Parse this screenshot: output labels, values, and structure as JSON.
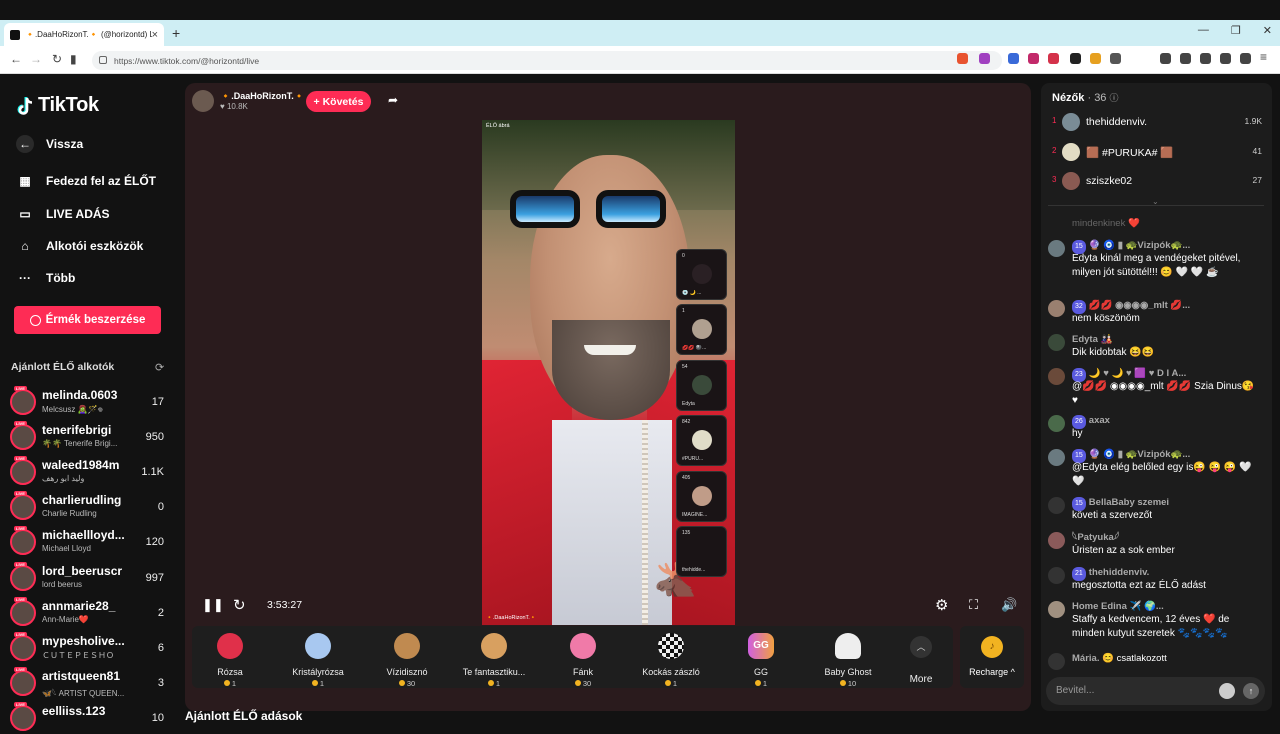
{
  "browser": {
    "tab_title": "🔸.DaaHoRizonT.🔸 (@horizontd) LIVE",
    "url": "https://www.tiktok.com/@horizontd/live"
  },
  "sidebar": {
    "logo": "TikTok",
    "items": [
      {
        "label": "Vissza",
        "icon": "back-arrow-icon"
      },
      {
        "label": "Fedezd fel az ÉLŐT",
        "icon": "calendar-icon"
      },
      {
        "label": "LIVE ADÁS",
        "icon": "camera-icon"
      },
      {
        "label": "Alkotói eszközök",
        "icon": "home-tools-icon"
      },
      {
        "label": "Több",
        "icon": "more-dots-icon"
      }
    ],
    "coins_button": "Érmék beszerzése",
    "recommended_heading": "Ajánlott ÉLŐ alkotók",
    "recommended": [
      {
        "name": "melinda.0603",
        "sub": "Melcsusz 🧟‍♀️🪄𖦹",
        "count": "17"
      },
      {
        "name": "tenerifebrigi",
        "sub": "🌴🌴 Tenerife Brigi...",
        "count": "950"
      },
      {
        "name": "waleed1984m",
        "sub": "وليد ابو رهف",
        "count": "1.1K"
      },
      {
        "name": "charlierudling",
        "sub": "Charlie Rudling",
        "count": "0"
      },
      {
        "name": "michaellloyd...",
        "sub": "Michael Lloyd",
        "count": "120"
      },
      {
        "name": "lord_beeruscr",
        "sub": "lord beerus",
        "count": "997"
      },
      {
        "name": "annmarie28_",
        "sub": "Ann-Marie❤️",
        "count": "2"
      },
      {
        "name": "mypesholive...",
        "sub": "ＣＵＴＥＰＥＳＨＯ",
        "count": "6"
      },
      {
        "name": "artistqueen81",
        "sub": "🦋𓆩 ARTIST QUEEN...",
        "count": "3"
      },
      {
        "name": "eelliiss.123",
        "sub": "",
        "count": "10"
      }
    ]
  },
  "live": {
    "host_name": "🔸.DaaHoRizonT.🔸",
    "followers": "10.8K",
    "follow_button": "+ Követés",
    "live_tag": "ÉLŐ ábrá",
    "video_name": "🔸.DaaHoRizonT.🔸",
    "guests": [
      {
        "num": "0",
        "label": "💿 🌙 ..."
      },
      {
        "num": "1",
        "label": "💋💋 🎱..."
      },
      {
        "num": "54",
        "label": "Edyta"
      },
      {
        "num": "842",
        "label": "#PURU..."
      },
      {
        "num": "405",
        "label": "IMAGINE..."
      },
      {
        "num": "135",
        "label": "thehidde..."
      }
    ],
    "time": "3:53:27"
  },
  "gifts": [
    {
      "name": "Rózsa",
      "price": "1",
      "color": "#e0304a"
    },
    {
      "name": "Kristályrózsa",
      "price": "1",
      "color": "#a8c8f0"
    },
    {
      "name": "Vízidisznó",
      "price": "30",
      "color": "#c08a50"
    },
    {
      "name": "Te fantasztiku...",
      "price": "1",
      "color": "#d8a060"
    },
    {
      "name": "Fánk",
      "price": "30",
      "color": "#f07aa8"
    },
    {
      "name": "Kockás zászló",
      "price": "1",
      "color": "#dddddd"
    },
    {
      "name": "GG",
      "price": "1",
      "color": "#d060e0"
    },
    {
      "name": "Baby Ghost",
      "price": "10",
      "color": "#eeeeee"
    }
  ],
  "more_label": "More",
  "recharge_label": "Recharge ^",
  "bottom_heading": "Ajánlott ÉLŐ adások",
  "chat": {
    "viewers_label": "Nézők",
    "viewers_count": "· 36",
    "top_viewers": [
      {
        "rank": "1",
        "name": "thehiddenviv.",
        "score": "1.9K"
      },
      {
        "rank": "2",
        "name": "🟫 #PURUKA# 🟫",
        "score": "41"
      },
      {
        "rank": "3",
        "name": "sziszke02",
        "score": "27"
      }
    ],
    "faded_line": "mindenkinek ❤️",
    "messages": [
      {
        "badge": "15",
        "user": "🔮 🧿 ▮ 🐢Vizipók🐢...",
        "text": "Edyta kinál meg a vendégeket pitével, milyen jót sütöttél!!! 😊 🤍 🤍 ☕"
      },
      {
        "badge": "32",
        "user": "💋💋 ◉◉◉◉_mlt 💋...",
        "text": "nem köszönöm"
      },
      {
        "badge": "",
        "user": "Edyta 🎎",
        "text": "Dik kidobtak 😆😆"
      },
      {
        "badge": "23",
        "user": "🌙 ♥ 🌙 ♥ 🟪 ♥ D I A...",
        "text": "@💋💋 ◉◉◉◉_mlt 💋💋 Szia Dinus😘 ♥"
      },
      {
        "badge": "26",
        "user": "axax",
        "text": "hy"
      },
      {
        "badge": "15",
        "user": "🔮 🧿 ▮ 🐢Vizipók🐢...",
        "text": "@Edyta elég belőled egy is😜 😜 😜 🤍 🤍"
      },
      {
        "badge": "15",
        "user": "BellaBaby szemei",
        "text": "követi a szervezőt"
      },
      {
        "badge": "",
        "user": "𓆩Patyuka𓆪",
        "text": "Úristen az a sok ember"
      },
      {
        "badge": "21",
        "user": "thehiddenviv.",
        "text": "megosztotta ezt az ÉLŐ adást"
      },
      {
        "badge": "",
        "user": "Home Edina ✈️ 🌍...",
        "text": "Staffy a kedvencem, 12 éves ❤️ de minden kutyut szeretek 🐾🐾🐾🐾"
      },
      {
        "badge": "",
        "user": "Mária. 😊",
        "text": "csatlakozott"
      }
    ],
    "input_placeholder": "Bevitel..."
  }
}
